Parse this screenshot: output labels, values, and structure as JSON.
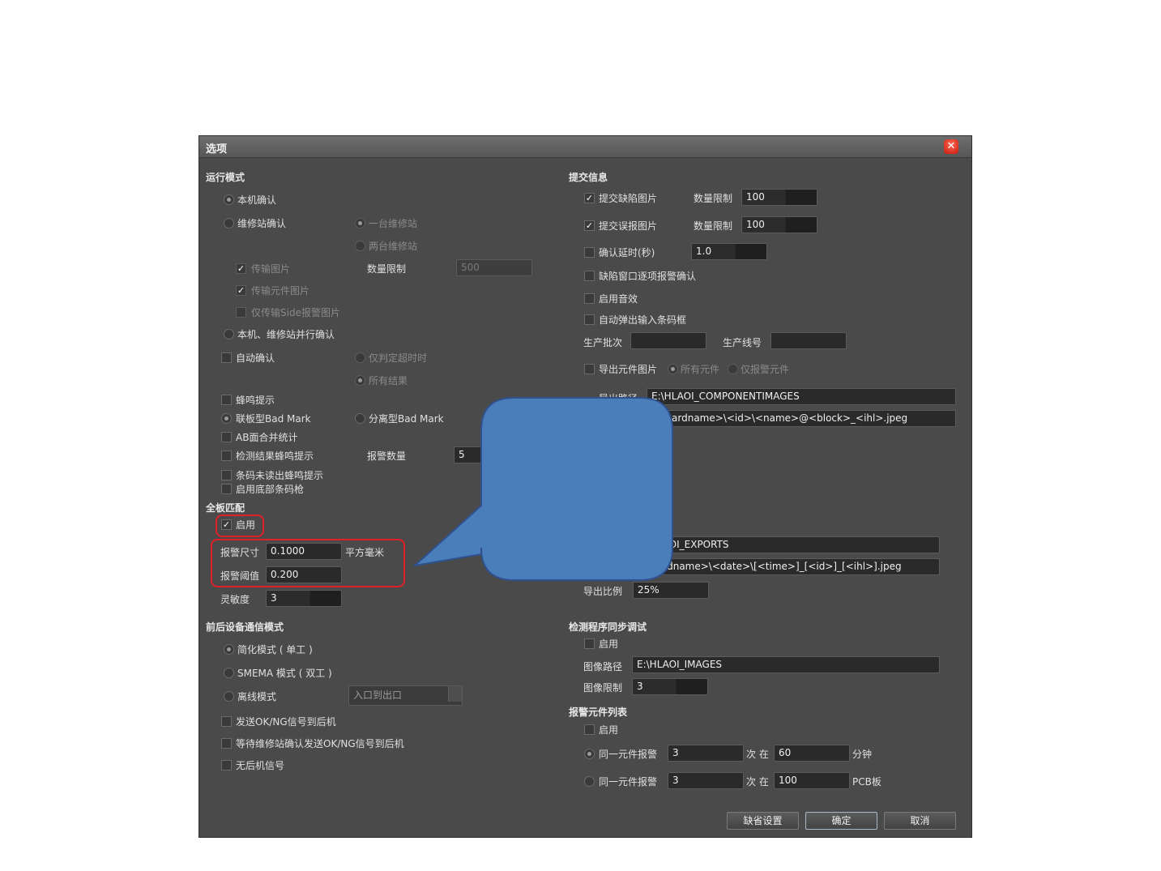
{
  "dialog": {
    "title": "选项",
    "close_symbol": "✕"
  },
  "left": {
    "run_mode": {
      "title": "运行模式",
      "local_confirm": "本机确认",
      "repair_confirm": "维修站确认",
      "one_repair": "一台维修站",
      "two_repair": "两台维修站",
      "transfer_image": "传输图片",
      "qty_limit_label": "数量限制",
      "qty_limit_value": "500",
      "transfer_component_image": "传输元件图片",
      "side_only": "仅传输Side报警图片",
      "parallel_confirm": "本机、维修站并行确认",
      "auto_confirm": "自动确认",
      "only_timeout": "仅判定超时时",
      "all_results": "所有结果",
      "buzzer": "蜂鸣提示",
      "joint_bad_mark": "联板型Bad Mark",
      "split_bad_mark": "分离型Bad Mark",
      "ab_merge": "AB面合并统计",
      "result_buzzer": "检测结果蜂鸣提示",
      "alarm_count_label": "报警数量",
      "alarm_count_value": "5",
      "barcode_buzzer": "条码未读出蜂鸣提示",
      "bottom_barcode": "启用底部条码枪"
    },
    "full_match": {
      "title": "全板匹配",
      "enable": "启用",
      "alarm_size_label": "报警尺寸",
      "alarm_size_value": "0.1000",
      "alarm_size_unit": "平方毫米",
      "alarm_threshold_label": "报警阈值",
      "alarm_threshold_value": "0.200",
      "sensitivity_label": "灵敏度",
      "sensitivity_value": "3"
    },
    "comm": {
      "title": "前后设备通信模式",
      "simple_mode": "简化模式 ( 单工 )",
      "smema_mode": "SMEMA 模式 ( 双工 )",
      "offline_mode": "离线模式",
      "direction_value": "入口到出口",
      "send_ok_ng": "发送OK/NG信号到后机",
      "wait_send_ok_ng": "等待维修站确认发送OK/NG信号到后机",
      "no_rear_signal": "无后机信号"
    }
  },
  "right": {
    "submit": {
      "title": "提交信息",
      "submit_defect": "提交缺陷图片",
      "defect_limit_label": "数量限制",
      "defect_limit_value": "100",
      "submit_false": "提交误报图片",
      "false_limit_label": "数量限制",
      "false_limit_value": "100",
      "confirm_delay": "确认延时(秒)",
      "confirm_delay_value": "1.0",
      "window_confirm": "缺陷窗口逐项报警确认",
      "enable_sound": "启用音效",
      "auto_barcode": "自动弹出输入条码框",
      "batch_label": "生产批次",
      "batch_value": "",
      "line_label": "生产线号",
      "line_value": "",
      "export_component": "导出元件图片",
      "all_components": "所有元件",
      "alarm_components": "仅报警元件",
      "export_path_label": "导出路径",
      "export_path_value": "E:\\HLAOI_COMPONENTIMAGES",
      "naming_value": "<boardname>\\<id>\\<name>@<block>_<ihl>.jpeg",
      "exports_path_value": "E:\\HLAOI_EXPORTS",
      "exports_naming_value": "<boardname>\\<date>\\[<time>]_[<id>]_[<ihl>].jpeg",
      "export_ratio_label": "导出比例",
      "export_ratio_value": "25%"
    },
    "sync_debug": {
      "title": "检测程序同步调试",
      "enable": "启用",
      "image_path_label": "图像路径",
      "image_path_value": "E:\\HLAOI_IMAGES",
      "image_limit_label": "图像限制",
      "image_limit_value": "3"
    },
    "alarm_list": {
      "title": "报警元件列表",
      "enable": "启用",
      "same_alarm_1": "同一元件报警",
      "count_1": "3",
      "times_in_1": "次 在",
      "period_1": "60",
      "unit_1": "分钟",
      "same_alarm_2": "同一元件报警",
      "count_2": "3",
      "times_in_2": "次 在",
      "period_2": "100",
      "unit_2": "PCB板"
    }
  },
  "buttons": {
    "default_settings": "缺省设置",
    "ok": "确定",
    "cancel": "取消"
  },
  "colors": {
    "dialog_bg": "#4a4a4a",
    "callout_fill": "#4a7ebb",
    "callout_stroke": "#2f528f",
    "highlight_red": "#e0202a"
  }
}
